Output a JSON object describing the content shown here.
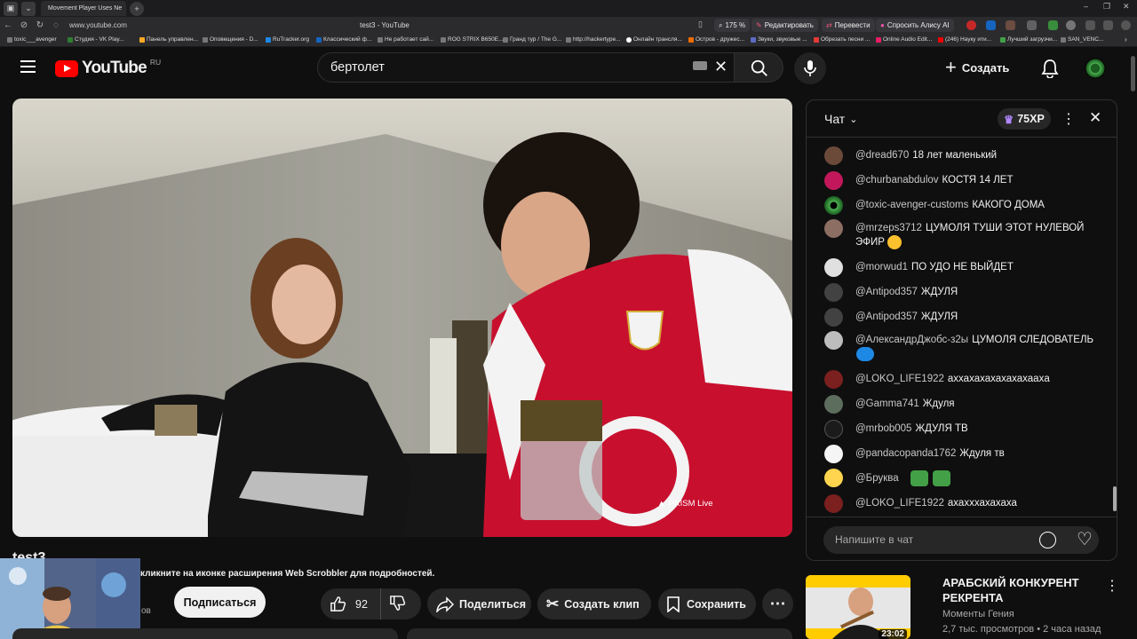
{
  "browser": {
    "tab_title": "Movement Player Uses Ne",
    "url": "www.youtube.com",
    "page_title": "test3 - YouTube",
    "zoom": "175 %",
    "toolbar": {
      "edit_label": "Редактировать",
      "translate_label": "Перевести",
      "alice_label": "Спросить Алису AI"
    },
    "bookmarks": [
      "toxic___avenger",
      "Студия - VK Play...",
      "Панель управлен...",
      "Оповещения - D...",
      "RuTracker.org",
      "Классический ф...",
      "Не работает сай...",
      "ROG STRIX B650E...",
      "Гранд тур / The G...",
      "http://hackertype...",
      "Онлайн трансля...",
      "Остров - дружес...",
      "Звуки, звуковые ...",
      "Обрезать песни ...",
      "Online Audio Edit...",
      "(246) Наукy ити...",
      "Лучший загрузчи...",
      "SAN_VENC..."
    ]
  },
  "header": {
    "logo_text": "YouTube",
    "region": "RU",
    "search_value": "бертолет",
    "create_label": "Создать"
  },
  "video": {
    "watermark": "PRISM Live",
    "title": "test3",
    "notice": "кликните на иконке расширения Web Scrobbler для подробностей.",
    "channel_suffix": "ов"
  },
  "actions": {
    "subscribe_label": "Подписаться",
    "like_count": "92",
    "share_label": "Поделиться",
    "clip_label": "Создать клип",
    "save_label": "Сохранить"
  },
  "chat": {
    "title": "Чат",
    "points": "75XP",
    "input_placeholder": "Напишите в чат",
    "messages": [
      {
        "author": "@dread670",
        "text": "18 лет маленький",
        "color": "#6b4a3a"
      },
      {
        "author": "@churbanabdulov",
        "text": "КОСТЯ 14 ЛЕТ",
        "color": "#c2185b"
      },
      {
        "author": "@toxic-avenger-customs",
        "text": "КАКОГО ДОМА",
        "color": "#2e7d32"
      },
      {
        "author": "@mrzeps3712",
        "text": "ЦУМОЛЯ ТУШИ ЭТОТ НУЛЕВОЙ ЭФИР",
        "color": "#8d6e63"
      },
      {
        "author": "@morwud1",
        "text": "ПО УДО НЕ ВЫЙДЕТ",
        "color": "#e0e0e0"
      },
      {
        "author": "@Antipod357",
        "text": "ЖДУЛЯ",
        "color": "#424242"
      },
      {
        "author": "@Antipod357",
        "text": "ЖДУЛЯ",
        "color": "#424242"
      },
      {
        "author": "@АлександрДжобс-з2ы",
        "text": "ЦУМОЛЯ СЛЕДОВАТЕЛЬ",
        "color": "#bdbdbd"
      },
      {
        "author": "@LOKO_LIFE1922",
        "text": "аххахахахахахахаахa",
        "color": "#7b1f1f"
      },
      {
        "author": "@Gamma741",
        "text": "Ждуля",
        "color": "#5d6d5d"
      },
      {
        "author": "@mrbob005",
        "text": "ЖДУЛЯ ТВ",
        "color": "#1b1b1b"
      },
      {
        "author": "@pandacopanda1762",
        "text": "Ждуля тв",
        "color": "#f5f5f5"
      },
      {
        "author": "@Бруква",
        "text": "",
        "color": "#ffd54f"
      },
      {
        "author": "@LOKO_LIFE1922",
        "text": "ахахххахахаха",
        "color": "#7b1f1f"
      }
    ]
  },
  "recommendation": {
    "title": "АРАБСКИЙ КОНКУРЕНТ РЕКРЕНТА",
    "channel": "Моменты Гения",
    "meta": "2,7 тыс. просмотров • 2 часа назад",
    "duration": "23:02"
  }
}
